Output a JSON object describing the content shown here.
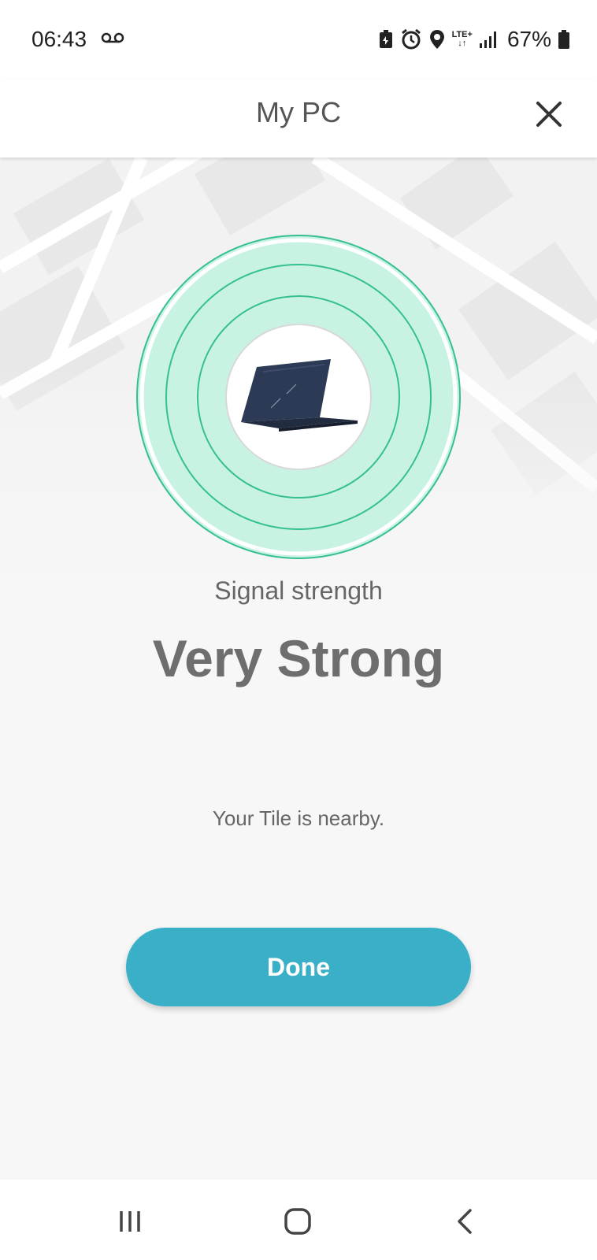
{
  "status_bar": {
    "time": "06:43",
    "network": "LTE+",
    "battery_percent": "67%"
  },
  "header": {
    "title": "My PC",
    "close_icon": "close-icon"
  },
  "signal": {
    "label": "Signal strength",
    "value": "Very Strong",
    "level": 1.0
  },
  "message": "Your Tile is nearby.",
  "done_button": {
    "label": "Done"
  },
  "nav_bar": {
    "icons": [
      "recent-apps-icon",
      "home-icon",
      "back-icon"
    ]
  },
  "colors": {
    "accent": "#3ab0c8",
    "radar": "#c8f3e3",
    "radar_ring": "#36c08f"
  }
}
